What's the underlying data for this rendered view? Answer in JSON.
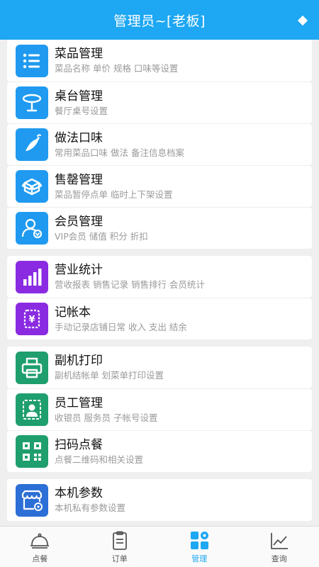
{
  "header": {
    "title": "管理员~[老板]"
  },
  "groups": [
    {
      "items": [
        {
          "title": "菜品管理",
          "subtitle": "菜品名称 单价 规格 口味等设置",
          "icon": "list-icon",
          "color": "#1f9af0"
        },
        {
          "title": "桌台管理",
          "subtitle": "餐厅桌号设置",
          "icon": "table-icon",
          "color": "#1f9af0"
        },
        {
          "title": "做法口味",
          "subtitle": "常用菜品口味 做法 备注信息档案",
          "icon": "chili-icon",
          "color": "#1f9af0"
        },
        {
          "title": "售罄管理",
          "subtitle": "菜品暂停点单 临时上下架设置",
          "icon": "box-icon",
          "color": "#1f9af0"
        },
        {
          "title": "会员管理",
          "subtitle": "VIP会员 储值 积分 折扣",
          "icon": "member-icon",
          "color": "#1f9af0"
        }
      ]
    },
    {
      "items": [
        {
          "title": "营业统计",
          "subtitle": "营收报表 销售记录 销售排行 会员统计",
          "icon": "bar-chart-icon",
          "color": "#8a2be2"
        },
        {
          "title": "记帐本",
          "subtitle": "手动记录店铺日常 收入 支出 结余",
          "icon": "ledger-icon",
          "color": "#8a2be2"
        }
      ]
    },
    {
      "items": [
        {
          "title": "副机打印",
          "subtitle": "副机结帐单 划菜单打印设置",
          "icon": "printer-icon",
          "color": "#1f9e6e"
        },
        {
          "title": "员工管理",
          "subtitle": "收银员 服务员 子帐号设置",
          "icon": "staff-icon",
          "color": "#1f9e6e"
        },
        {
          "title": "扫码点餐",
          "subtitle": "点餐二维码和相关设置",
          "icon": "qrcode-icon",
          "color": "#1f9e6e"
        }
      ]
    },
    {
      "items": [
        {
          "title": "本机参数",
          "subtitle": "本机私有参数设置",
          "icon": "shop-settings-icon",
          "color": "#2c6fd6"
        }
      ]
    }
  ],
  "tabs": [
    {
      "label": "点餐",
      "icon": "cloche-icon",
      "active": false
    },
    {
      "label": "订单",
      "icon": "clipboard-icon",
      "active": false
    },
    {
      "label": "管理",
      "icon": "grid-gear-icon",
      "active": true
    },
    {
      "label": "查询",
      "icon": "line-chart-icon",
      "active": false
    }
  ],
  "colors": {
    "header": "#1ea7f2",
    "active_tab": "#1ea7f2"
  }
}
